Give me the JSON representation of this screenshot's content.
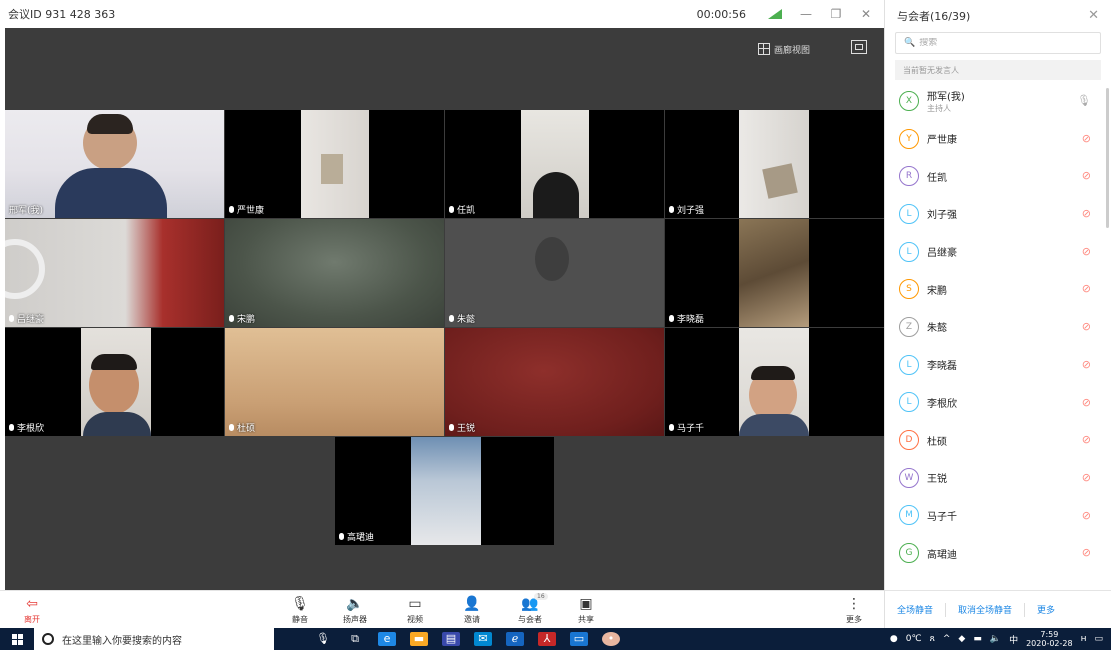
{
  "window": {
    "meeting_id": "会议ID 931 428 363",
    "timer": "00:00:56"
  },
  "view": {
    "gallery_label": "画廊视图"
  },
  "tiles": [
    {
      "name": "邢军(我)"
    },
    {
      "name": "严世康"
    },
    {
      "name": "任凯"
    },
    {
      "name": "刘子强"
    },
    {
      "name": "吕继豪"
    },
    {
      "name": "宋鹏"
    },
    {
      "name": "朱懿"
    },
    {
      "name": "李晓磊"
    },
    {
      "name": "李根欣"
    },
    {
      "name": "杜硕"
    },
    {
      "name": "王锐"
    },
    {
      "name": "马子千"
    },
    {
      "name": "高珺迪"
    }
  ],
  "toolbar": {
    "leave": "离开",
    "mute": "静音",
    "speaker": "扬声器",
    "video": "视频",
    "invite": "邀请",
    "participants": "与会者",
    "participants_badge": "16",
    "share": "共享",
    "more": "更多"
  },
  "panel": {
    "title": "与会者(16/39)",
    "search_placeholder": "搜索",
    "no_speaker": "当前暂无发言人",
    "participants": [
      {
        "initial": "X",
        "name": "邢军(我)",
        "sub": "主持人",
        "color": "#4caf50"
      },
      {
        "initial": "Y",
        "name": "严世康",
        "sub": "",
        "color": "#ff9800"
      },
      {
        "initial": "R",
        "name": "任凯",
        "sub": "",
        "color": "#9575cd"
      },
      {
        "initial": "L",
        "name": "刘子强",
        "sub": "",
        "color": "#4fc3f7"
      },
      {
        "initial": "L",
        "name": "吕继豪",
        "sub": "",
        "color": "#4fc3f7"
      },
      {
        "initial": "S",
        "name": "宋鹏",
        "sub": "",
        "color": "#ff9800"
      },
      {
        "initial": "Z",
        "name": "朱懿",
        "sub": "",
        "color": "#9e9e9e"
      },
      {
        "initial": "L",
        "name": "李晓磊",
        "sub": "",
        "color": "#4fc3f7"
      },
      {
        "initial": "L",
        "name": "李根欣",
        "sub": "",
        "color": "#4fc3f7"
      },
      {
        "initial": "D",
        "name": "杜硕",
        "sub": "",
        "color": "#ff7043"
      },
      {
        "initial": "W",
        "name": "王锐",
        "sub": "",
        "color": "#9575cd"
      },
      {
        "initial": "M",
        "name": "马子千",
        "sub": "",
        "color": "#4fc3f7"
      },
      {
        "initial": "G",
        "name": "高珺迪",
        "sub": "",
        "color": "#4caf50"
      }
    ],
    "mute_all": "全场静音",
    "unmute_all": "取消全场静音",
    "more": "更多"
  },
  "taskbar": {
    "search_placeholder": "在这里输入你要搜索的内容",
    "temperature": "0℃",
    "ime": "中",
    "time": "7:59",
    "date": "2020-02-28"
  }
}
